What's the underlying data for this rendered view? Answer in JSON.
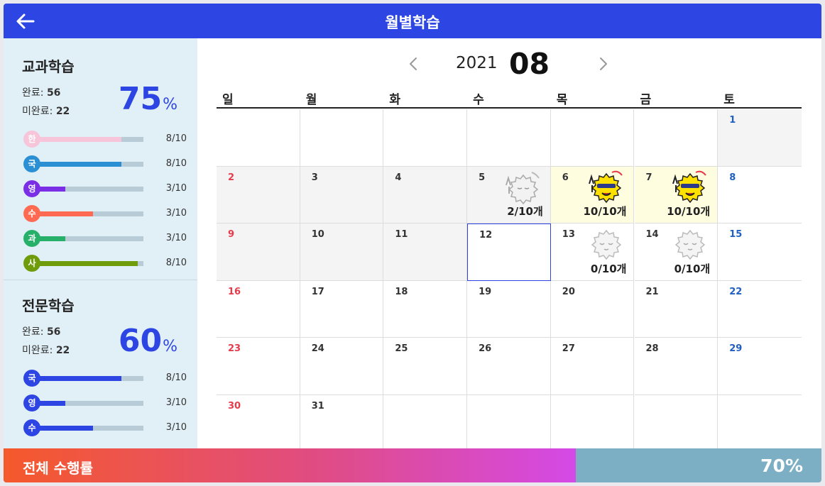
{
  "header": {
    "title": "월별학습",
    "back_icon": "arrow-left-icon"
  },
  "colors": {
    "primary": "#2d46e3",
    "sunday": "#e63b4b",
    "saturday": "#1f5fbf",
    "highlight": "#fefde0"
  },
  "subject_study": {
    "title": "교과학습",
    "complete_label": "완료:",
    "complete_value": "56",
    "incomplete_label": "미완료:",
    "incomplete_value": "22",
    "percent": "75",
    "percent_unit": "%",
    "subjects": [
      {
        "badge": "한",
        "color": "#f7c5da",
        "bar": "#f7c5da",
        "count": "8/10",
        "progress": 0.8
      },
      {
        "badge": "국",
        "color": "#2a8fd3",
        "bar": "#2a8fd3",
        "count": "8/10",
        "progress": 0.8
      },
      {
        "badge": "영",
        "color": "#7a2fe6",
        "bar": "#7a2fe6",
        "count": "3/10",
        "progress": 0.3
      },
      {
        "badge": "수",
        "color": "#ff6a52",
        "bar": "#ff6a52",
        "count": "3/10",
        "progress": 0.55
      },
      {
        "badge": "과",
        "color": "#27b06a",
        "bar": "#27b06a",
        "count": "3/10",
        "progress": 0.3
      },
      {
        "badge": "사",
        "color": "#6f9c0a",
        "bar": "#6f9c0a",
        "count": "8/10",
        "progress": 0.95
      }
    ]
  },
  "special_study": {
    "title": "전문학습",
    "complete_label": "완료:",
    "complete_value": "56",
    "incomplete_label": "미완료:",
    "incomplete_value": "22",
    "percent": "60",
    "percent_unit": "%",
    "subjects": [
      {
        "badge": "국",
        "color": "#2d46e3",
        "bar": "#2d46e3",
        "count": "8/10",
        "progress": 0.8
      },
      {
        "badge": "영",
        "color": "#2d46e3",
        "bar": "#2d46e3",
        "count": "3/10",
        "progress": 0.3
      },
      {
        "badge": "수",
        "color": "#2d46e3",
        "bar": "#2d46e3",
        "count": "3/10",
        "progress": 0.55
      }
    ]
  },
  "calendar": {
    "year": "2021",
    "month": "08",
    "prev_icon": "chevron-left-icon",
    "next_icon": "chevron-right-icon",
    "weekdays": [
      "일",
      "월",
      "화",
      "수",
      "목",
      "금",
      "토"
    ],
    "weeks": [
      [
        {},
        {},
        {},
        {},
        {},
        {},
        {
          "day": "1",
          "bg": "gray"
        }
      ],
      [
        {
          "day": "2",
          "bg": "gray"
        },
        {
          "day": "3",
          "bg": "gray"
        },
        {
          "day": "4",
          "bg": "gray"
        },
        {
          "day": "5",
          "bg": "gray",
          "count": "2/10개",
          "sticker": "sad"
        },
        {
          "day": "6",
          "bg": "yellow",
          "count": "10/10개",
          "sticker": "happy"
        },
        {
          "day": "7",
          "bg": "yellow",
          "count": "10/10개",
          "sticker": "happy"
        },
        {
          "day": "8"
        }
      ],
      [
        {
          "day": "9",
          "bg": "gray"
        },
        {
          "day": "10",
          "bg": "gray"
        },
        {
          "day": "11",
          "bg": "gray"
        },
        {
          "day": "12",
          "today": true
        },
        {
          "day": "13",
          "count": "0/10개",
          "sticker": "sleep"
        },
        {
          "day": "14",
          "count": "0/10개",
          "sticker": "sleep"
        },
        {
          "day": "15"
        }
      ],
      [
        {
          "day": "16"
        },
        {
          "day": "17"
        },
        {
          "day": "18"
        },
        {
          "day": "19"
        },
        {
          "day": "20"
        },
        {
          "day": "21"
        },
        {
          "day": "22"
        }
      ],
      [
        {
          "day": "23"
        },
        {
          "day": "24"
        },
        {
          "day": "25"
        },
        {
          "day": "26"
        },
        {
          "day": "27"
        },
        {
          "day": "28"
        },
        {
          "day": "29"
        }
      ],
      [
        {
          "day": "30"
        },
        {
          "day": "31"
        },
        {},
        {},
        {},
        {},
        {}
      ]
    ]
  },
  "footer": {
    "label": "전체 수행률",
    "value": "70%",
    "progress": 0.7
  }
}
